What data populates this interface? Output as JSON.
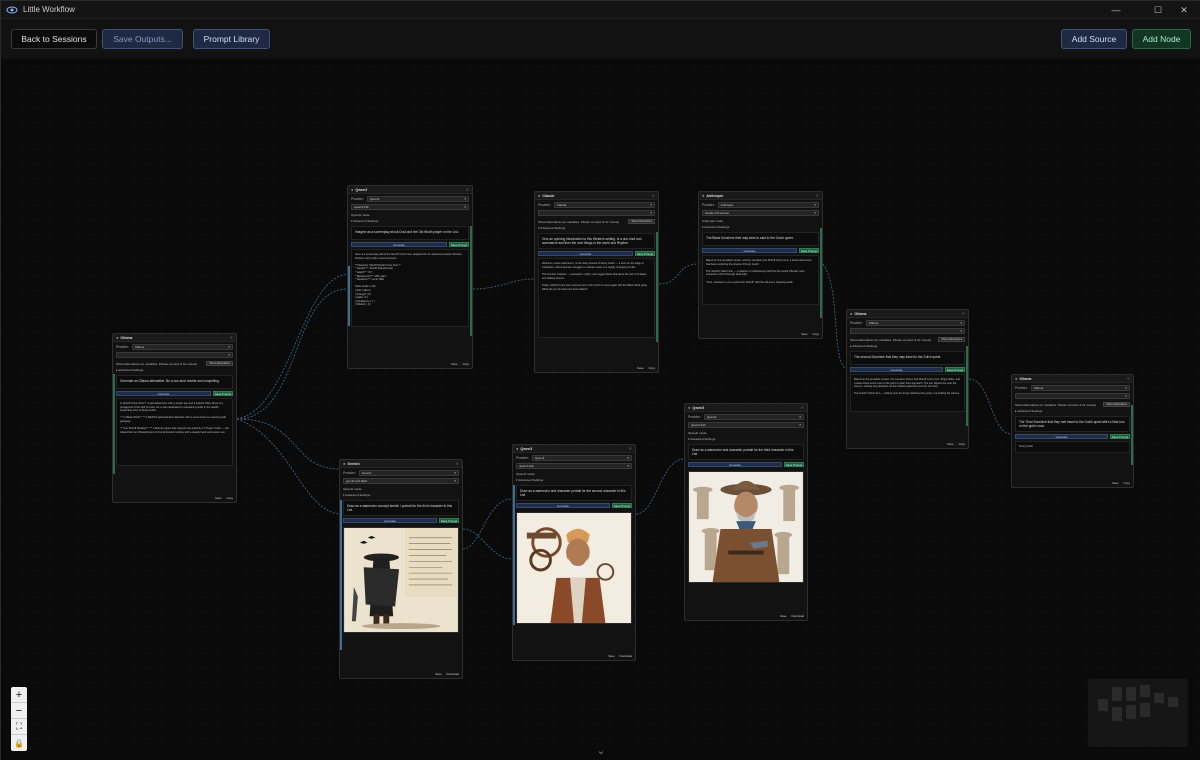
{
  "window": {
    "title": "Little Workflow",
    "min": "—",
    "max": "☐",
    "close": "✕"
  },
  "toolbar": {
    "back": "Back to Sessions",
    "save_outputs": "Save Outputs...",
    "prompt_library": "Prompt Library",
    "add_source": "Add Source",
    "add_node": "Add Node"
  },
  "common": {
    "provider": "Provider:",
    "generate": "Generate",
    "save_prompt": "Save Prompt",
    "open_ai_mode": "OpenAI mode",
    "advanced": "▸ Advanced Settings",
    "advanced_open": "▾ Advanced Settings",
    "show_alts": "Show Alternatives (or variables. Please connect & for review)",
    "show_alts_short": "Show Alternatives",
    "save": "Save",
    "copy": "Copy",
    "download": "Download"
  },
  "nodes": {
    "source": {
      "name": "Ollama",
      "provider": "Ollama",
      "model": "",
      "prompt": "Generate an Ollama alternative. Be a one-shot rewrite and compelling.",
      "output": "In Sheriff Cross Shirt™ 4 gold adventurer with a simple eye and 4 sparkle Silver River is a protagonist of the wild Frontier. He is also dedicated to maintaining order in the rapidly expanding town of Dusty Gulch.\n\n™ In Black Wind™ ™ A FRAN'S administrative Rancher with a commitment to ensuring safe gangway.\n\n™ Sun Sheriff Shadow™ ™ a Mission figure that respects the authority of \"Dusty\" Gulch — His Ahead the men Sharpshooter of A local frontier Cowboy with a steady hand and a keen eye."
    },
    "n1": {
      "name": "Qwen3",
      "provider": "Qwen3",
      "model": "qwen3:14b",
      "openai": "OpenAI mode",
      "prompt": "Imagine as a screenplay about Dust and the Old Wrath player on the List.",
      "output": "Here is a screenplay about the Sheriff Cross One, designed for an adventure-based Victorian Western story told in second person.\n\n**Character Sheriff Sheriff Cross One:**\n* Gender™: Sheriff Sharpshooter\n* Height™: 6'1\"\n* Background™: Mild mann\n* Weapons™: Lever Rifle\n\nStats (scale 1-10):\n| Stat | Value |\n| Strength | 8 |\n| Agility | 6 |\n| Intelligence | 7 |\n| Wisdom | 9 |"
    },
    "n2": {
      "name": "Claude",
      "provider": "Claude",
      "model": "",
      "prompt": "Give an opening introduction to this Western setting. Is a one-shot and summarize and then the next things in the world and Rhythm.",
      "output": "Welcome, brave adventurer, to the dusty streets of Dusty Gulch — a town on the edge of civilization, where lawmen struggle to maintain order in a rapidly changing frontier.\n\nThe Frontier Outpost — a powerful, mythic, and rugged place that faces the risk of Outlaws and railway barons.\n\nToday, Sheriff Cross One ventures out to the Gulch to meet again with the Black Wind gang. What will you do when the dust settles?"
    },
    "n3": {
      "name": "Anthropic",
      "provider": "Anthropic",
      "model": "claude-3-5-sonnet",
      "openai": "Anthropic mode",
      "prompt": "The Black Sunshine their way seek to said to the Gulch queer.",
      "output": "Based on the provided context, and the narrative that Sheriff Cross One, a brave adventurer, had been exploring the streets of Dusty Gulch.\n\nThe Sheriff's Silent Son — a relative of misbehaving sheriff at the Gulch's Border town, scanned in the lit-through dusk light.\n\n\"Sent, reluctant to you a ghost the Sheriff\" said the old-timer, stepping aside."
    },
    "n4": {
      "name": "Gemini",
      "provider": "Gemini",
      "model": "gemini-2.0-flash",
      "prompt": "Draw as a watercolor concept sketch / portrait for the third character in this List.",
      "output": ""
    },
    "n5": {
      "name": "Qwen3",
      "provider": "Qwen3",
      "model": "qwen3:14b",
      "openai": "OpenAI mode",
      "prompt": "Draw as a watercolor and character portrait for the second character in this List.",
      "output": ""
    },
    "n6": {
      "name": "Qwen3",
      "provider": "Qwen3",
      "model": "qwen3:14b",
      "openai": "OpenAI mode",
      "prompt": "Draw as a watercolor and character portrait for the third character in this List.",
      "output": ""
    },
    "n7": {
      "name": "Ollama",
      "provider": "Ollama",
      "model": "",
      "prompt": "The second Sunshine that they may travel to the Gulch quest.",
      "output": "Based on the provided context, the narrative shows that Sheriff Cross One, Bright Rider, and a determined scout meet in the gulch to plan their approach. The sun dipped low over the canyon, casting long shadows as the outlaws gathered near the old mine.\n\nThe Gulch's Silent Son — lurking near the fringe watching the group, but holding his silence."
    },
    "n8": {
      "name": "Ollama",
      "provider": "Ollama",
      "model": "",
      "prompt": "The Third Sunshine that they met travel to the Gulch quest after a final turn on the gulch road.",
      "output": "Dusty Gulch"
    }
  },
  "colors": {
    "edge": "#3f6e92",
    "accent_green": "#2b6a4a"
  }
}
